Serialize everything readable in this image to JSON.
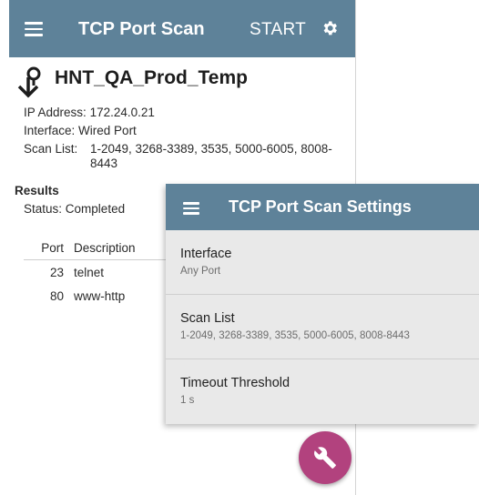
{
  "appbar": {
    "title": "TCP Port Scan",
    "start_label": "START",
    "menu_icon": "menu-icon",
    "settings_icon": "gear-icon"
  },
  "target": {
    "name": "HNT_QA_Prod_Temp",
    "icon": "target-pin-icon"
  },
  "info": {
    "ip_label": "IP Address:",
    "ip_value": "172.24.0.21",
    "interface_label": "Interface:",
    "interface_value": "Wired Port",
    "scan_label": "Scan List:",
    "scan_value": "1-2049, 3268-3389, 3535, 5000-6005, 8008-8443"
  },
  "results": {
    "heading": "Results",
    "status_label": "Status:",
    "status_value": "Completed",
    "columns": [
      "Port",
      "Description"
    ],
    "rows": [
      {
        "port": "23",
        "description": "telnet"
      },
      {
        "port": "80",
        "description": "www-http"
      }
    ]
  },
  "fab": {
    "icon": "wrench-icon",
    "color": "#b2427e"
  },
  "settings": {
    "title": "TCP Port Scan Settings",
    "items": [
      {
        "title": "Interface",
        "value": "Any Port"
      },
      {
        "title": "Scan List",
        "value": "1-2049, 3268-3389, 3535, 5000-6005, 8008-8443"
      },
      {
        "title": "Timeout Threshold",
        "value": "1 s"
      }
    ]
  },
  "colors": {
    "appbar": "#5e8299",
    "accent": "#b2427e",
    "panel": "#e9e9e9"
  }
}
